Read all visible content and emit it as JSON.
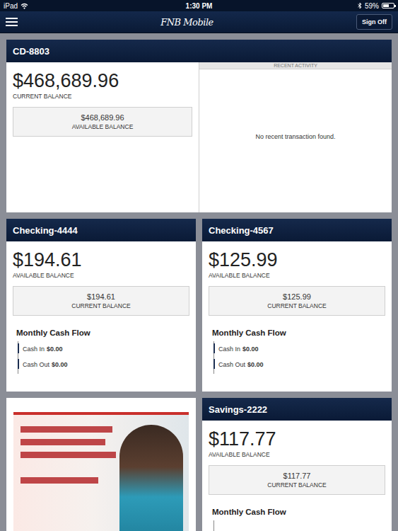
{
  "status_bar": {
    "device": "iPad",
    "time": "1:30 PM",
    "battery": "59%",
    "battery_level": 0.59
  },
  "nav": {
    "title": "FNB Mobile",
    "sign_off": "Sign Off"
  },
  "cd": {
    "name": "CD-8803",
    "primary_amount": "$468,689.96",
    "primary_label": "CURRENT BALANCE",
    "secondary_amount": "$468,689.96",
    "secondary_label": "AVAILABLE BALANCE",
    "activity_title": "RECENT ACTIVITY",
    "activity_empty": "No recent transaction found."
  },
  "accounts": [
    {
      "kind": "account",
      "name": "Checking-4444",
      "primary_amount": "$194.61",
      "primary_label": "AVAILABLE BALANCE",
      "secondary_amount": "$194.61",
      "secondary_label": "CURRENT BALANCE",
      "cash_flow": {
        "title": "Monthly Cash Flow",
        "items": [
          {
            "label": "Cash In",
            "value": "$0.00"
          },
          {
            "label": "Cash Out",
            "value": "$0.00"
          }
        ]
      }
    },
    {
      "kind": "account",
      "name": "Checking-4567",
      "primary_amount": "$125.99",
      "primary_label": "AVAILABLE BALANCE",
      "secondary_amount": "$125.99",
      "secondary_label": "CURRENT BALANCE",
      "cash_flow": {
        "title": "Monthly Cash Flow",
        "items": [
          {
            "label": "Cash In",
            "value": "$0.00"
          },
          {
            "label": "Cash Out",
            "value": "$0.00"
          }
        ]
      }
    },
    {
      "kind": "promo"
    },
    {
      "kind": "account",
      "name": "Savings-2222",
      "primary_amount": "$117.77",
      "primary_label": "AVAILABLE BALANCE",
      "secondary_amount": "$117.77",
      "secondary_label": "CURRENT BALANCE",
      "cash_flow": {
        "title": "Monthly Cash Flow",
        "items": []
      }
    }
  ]
}
